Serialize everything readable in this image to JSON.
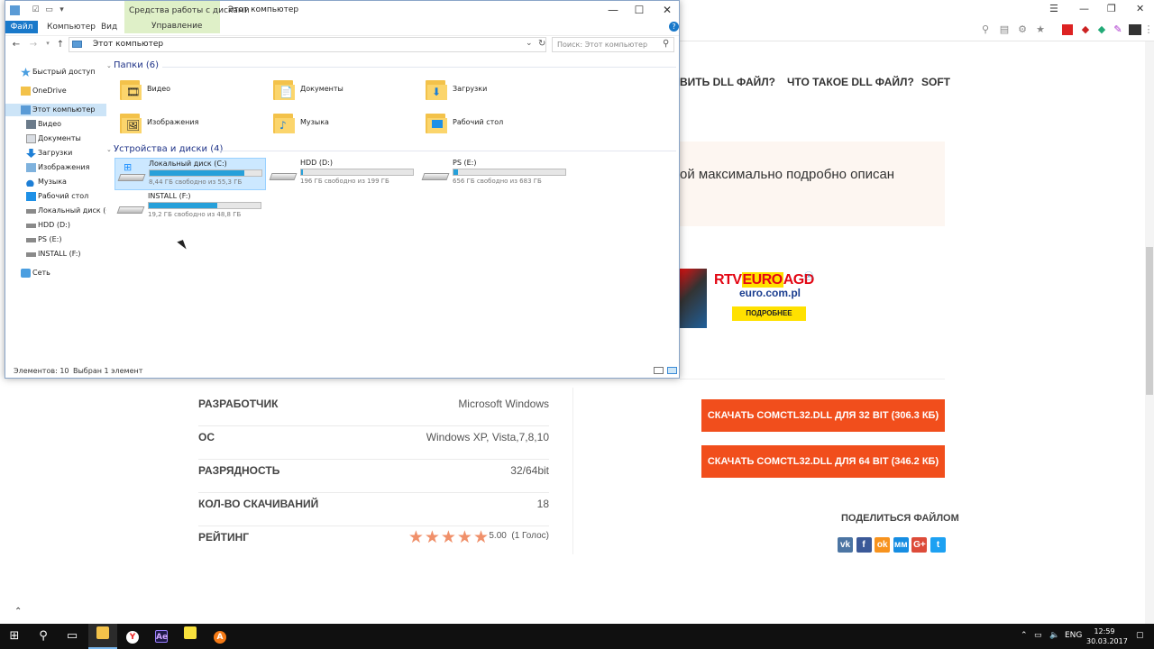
{
  "explorer": {
    "title": "Этот компьютер",
    "context_tab": "Средства работы с дисками",
    "context_subtab": "Управление",
    "ribbon_tabs": [
      "Файл",
      "Компьютер",
      "Вид"
    ],
    "address": "Этот компьютер",
    "search_placeholder": "Поиск: Этот компьютер",
    "nav": [
      {
        "label": "Быстрый доступ",
        "icon": "star-icon"
      },
      {
        "label": "OneDrive",
        "icon": "onedrive-icon"
      },
      {
        "label": "Этот компьютер",
        "icon": "computer-icon",
        "selected": true
      },
      {
        "label": "Видео",
        "icon": "video-folder-icon"
      },
      {
        "label": "Документы",
        "icon": "documents-folder-icon"
      },
      {
        "label": "Загрузки",
        "icon": "downloads-folder-icon"
      },
      {
        "label": "Изображения",
        "icon": "pictures-folder-icon"
      },
      {
        "label": "Музыка",
        "icon": "music-folder-icon"
      },
      {
        "label": "Рабочий стол",
        "icon": "desktop-folder-icon"
      },
      {
        "label": "Локальный диск (C",
        "icon": "drive-icon"
      },
      {
        "label": "HDD (D:)",
        "icon": "drive-icon"
      },
      {
        "label": "PS (E:)",
        "icon": "drive-icon"
      },
      {
        "label": "INSTALL (F:)",
        "icon": "drive-icon"
      },
      {
        "label": "Сеть",
        "icon": "network-icon"
      }
    ],
    "folders_header": "Папки (6)",
    "folders": [
      "Видео",
      "Документы",
      "Загрузки",
      "Изображения",
      "Музыка",
      "Рабочий стол"
    ],
    "drives_header": "Устройства и диски (4)",
    "drives": [
      {
        "name": "Локальный диск (C:)",
        "free": "8,44 ГБ свободно из 55,3 ГБ",
        "used_fraction": 0.85,
        "selected": true
      },
      {
        "name": "HDD (D:)",
        "free": "196 ГБ свободно из 199 ГБ",
        "used_fraction": 0.015
      },
      {
        "name": "PS (E:)",
        "free": "656 ГБ свободно из 683 ГБ",
        "used_fraction": 0.04
      },
      {
        "name": "INSTALL (F:)",
        "free": "19,2 ГБ свободно из 48,8 ГБ",
        "used_fraction": 0.61
      }
    ],
    "status_items": "Элементов: 10",
    "status_selected": "Выбран 1 элемент"
  },
  "site": {
    "nav": [
      "ВИТЬ DLL ФАЙЛ?",
      "ЧТО ТАКОЕ DLL ФАЙЛ?",
      "SOFT"
    ],
    "notice": "ой максимально подробно описан",
    "ad": {
      "logo": "RTV EURO AGD",
      "url": "euro.com.pl",
      "button": "ПОДРОБНЕЕ"
    },
    "info": [
      {
        "key": "РАЗРАБОТЧИК",
        "value": "Microsoft Windows"
      },
      {
        "key": "ОС",
        "value": "Windows XP, Vista,7,8,10"
      },
      {
        "key": "РАЗРЯДНОСТЬ",
        "value": "32/64bit"
      },
      {
        "key": "КОЛ-ВО СКАЧИВАНИЙ",
        "value": "18"
      }
    ],
    "rating_key": "РЕЙТИНГ",
    "rating_value": "5.00",
    "rating_votes": "(1 Голос)",
    "download_32": "СКАЧАТЬ COMCTL32.DLL ДЛЯ 32 BIT (306.3 КБ)",
    "download_64": "СКАЧАТЬ COMCTL32.DLL ДЛЯ 64 BIT (346.2 КБ)",
    "share_title": "ПОДЕЛИТЬСЯ ФАЙЛОМ",
    "share": [
      {
        "label": "vk",
        "color": "#4c75a3"
      },
      {
        "label": "f",
        "color": "#3b5998"
      },
      {
        "label": "ok",
        "color": "#f7931e"
      },
      {
        "label": "мм",
        "color": "#168de2"
      },
      {
        "label": "G+",
        "color": "#dd4b39"
      },
      {
        "label": "t",
        "color": "#1da1f2"
      }
    ]
  },
  "taskbar": {
    "lang": "ENG",
    "time": "12:59",
    "date": "30.03.2017"
  }
}
